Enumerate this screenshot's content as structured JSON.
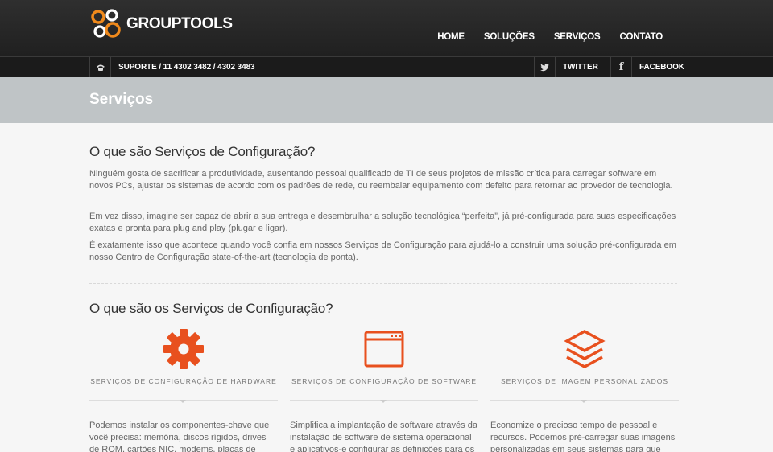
{
  "brand": {
    "name": "GROUPTOOLS"
  },
  "nav": {
    "items": [
      "HOME",
      "SOLUÇÕES",
      "SERVIÇOS",
      "CONTATO"
    ]
  },
  "infobar": {
    "support": "SUPORTE / 11 4302 3482 / 4302 3483",
    "twitter": "TWITTER",
    "facebook": "FACEBOOK"
  },
  "page": {
    "title": "Serviços"
  },
  "section1": {
    "heading": "O que são Serviços de Configuração?",
    "paragraphs": [
      "Ninguém gosta de sacrificar a produtividade, ausentando pessoal qualificado de TI de seus projetos de missão crítica para carregar software em novos PCs, ajustar os sistemas de acordo com os padrões de rede, ou reembalar equipamento com defeito para retornar ao provedor de tecnologia.",
      "Em vez disso, imagine ser capaz de abrir a sua entrega e desembrulhar a solução tecnológica “perfeita”, já pré-configurada para suas especificações exatas e pronta para plug and play (plugar e ligar).",
      "É exatamente isso que acontece quando você confia em nossos Serviços de Configuração para ajudá-lo a construir uma solução pré-configurada em nosso Centro de Configuração state-of-the-art (tecnologia de ponta)."
    ]
  },
  "section2": {
    "heading": "O que são os Serviços de Configuração?",
    "services": [
      {
        "icon": "gear-icon",
        "title": "SERVIÇOS DE CONFIGURAÇÃO DE HARDWARE",
        "desc": "Podemos instalar os componentes-chave que você precisa: memória, discos rígidos, drives de ROM, cartões NIC, modems, placas de vídeo e"
      },
      {
        "icon": "browser-window-icon",
        "title": "SERVIÇOS DE CONFIGURAÇÃO DE SOFTWARE",
        "desc": "Simplifica a implantação de software através da instalação de software de sistema operacional e aplicativos-e configurar as definições para os"
      },
      {
        "icon": "layers-icon",
        "title": "SERVIÇOS DE IMAGEM PERSONALIZADOS",
        "desc": "Economize o precioso tempo de pessoal e recursos. Podemos pré-carregar suas imagens personalizadas em seus sistemas para que todas"
      }
    ]
  },
  "colors": {
    "accent": "#e8501e",
    "header": "#262626",
    "titleband": "#bfc4c6"
  }
}
